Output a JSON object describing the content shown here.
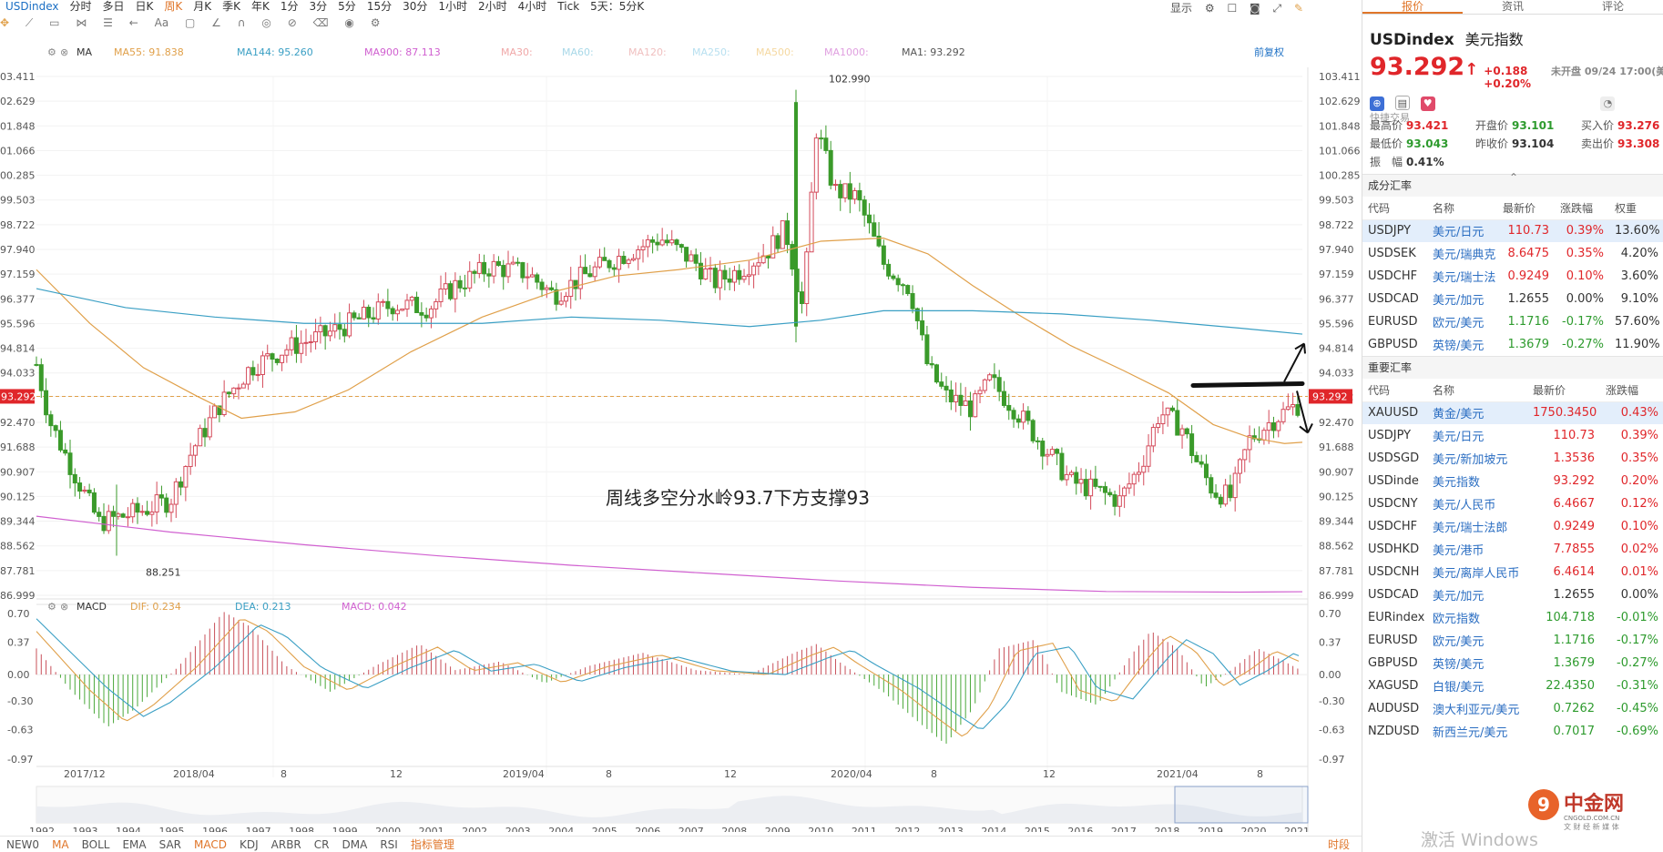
{
  "topbar": {
    "symbol": "USDindex",
    "periods": [
      "分时",
      "多日",
      "日K",
      "周K",
      "月K",
      "季K",
      "年K",
      "1分",
      "3分",
      "5分",
      "15分",
      "30分",
      "1小时",
      "2小时",
      "4小时",
      "Tick",
      "5天：5分K"
    ],
    "active_period": "周K",
    "display_label": "显示"
  },
  "ma_legend": {
    "name": "MA",
    "items": [
      {
        "label": "MA55: 91.838",
        "color": "#e0a04a"
      },
      {
        "label": "MA144: 95.260",
        "color": "#3a9fc4"
      },
      {
        "label": "MA900: 87.113",
        "color": "#d060d0"
      },
      {
        "label": "MA30:",
        "color": "#f0a8a8"
      },
      {
        "label": "MA60:",
        "color": "#a8d8e8"
      },
      {
        "label": "MA120:",
        "color": "#f0c0c0"
      },
      {
        "label": "MA250:",
        "color": "#b8e0f0"
      },
      {
        "label": "MA500:",
        "color": "#f5d8a0"
      },
      {
        "label": "MA1000:",
        "color": "#e0a0e0"
      },
      {
        "label": "MA1: 93.292",
        "color": "#555555"
      }
    ],
    "adjust_label": "前复权"
  },
  "price_axis": {
    "ticks": [
      "103.411",
      "102.629",
      "101.848",
      "101.066",
      "100.285",
      "99.503",
      "98.722",
      "97.940",
      "97.159",
      "96.377",
      "95.596",
      "94.814",
      "94.033",
      "93.292",
      "92.470",
      "91.688",
      "90.907",
      "90.125",
      "89.344",
      "88.562",
      "87.781",
      "86.999"
    ],
    "left_ticks": [
      "03.411",
      "02.629",
      "01.848",
      "01.066",
      "00.285",
      "99.503",
      "98.722",
      "97.940",
      "97.159",
      "96.377",
      "95.596",
      "94.814",
      "94.033",
      "93.292",
      "92.470",
      "91.688",
      "90.907",
      "90.125",
      "89.344",
      "88.562",
      "87.781",
      "86.999"
    ],
    "current": "93.292"
  },
  "annotations": {
    "high": "102.990",
    "low": "88.251",
    "note": "周线多空分水岭93.7下方支撑93"
  },
  "time_axis": [
    "2017/12",
    "2018/04",
    "8",
    "12",
    "2019/04",
    "8",
    "12",
    "2020/04",
    "8",
    "12",
    "2021/04",
    "8"
  ],
  "macd_legend": {
    "name": "MACD",
    "dif": "DIF: 0.234",
    "dea": "DEA: 0.213",
    "macd": "MACD: 0.042",
    "ticks": [
      "0.70",
      "0.37",
      "0.00",
      "-0.30",
      "-0.63",
      "-0.97"
    ]
  },
  "overview_years": [
    "1992",
    "1993",
    "1994",
    "1995",
    "1996",
    "1997",
    "1998",
    "1999",
    "2000",
    "2001",
    "2002",
    "2003",
    "2004",
    "2005",
    "2006",
    "2007",
    "2008",
    "2009",
    "2010",
    "2011",
    "2012",
    "2013",
    "2014",
    "2015",
    "2016",
    "2017",
    "2018",
    "2019",
    "2020",
    "2021"
  ],
  "bottom_indicators": [
    "NEW0",
    "MA",
    "BOLL",
    "EMA",
    "SAR",
    "MACD",
    "KDJ",
    "ARBR",
    "CR",
    "DMA",
    "RSI",
    "指标管理"
  ],
  "bottom_active": [
    "MA",
    "MACD"
  ],
  "bottom_right": "时段",
  "side": {
    "tabs": [
      "报价",
      "资讯",
      "评论"
    ],
    "active_tab": "报价",
    "symbol": "USDindex",
    "name_cn": "美元指数",
    "price": "93.292",
    "change": "+0.188",
    "change_pct": "+0.20%",
    "status": "未开盘 09/24 17:00(美",
    "quick_trade": "快捷交易",
    "stats": [
      {
        "label": "最高价",
        "value": "93.421",
        "tone": "up"
      },
      {
        "label": "开盘价",
        "value": "93.101",
        "tone": "dn"
      },
      {
        "label": "买入价",
        "value": "93.276",
        "tone": "up"
      },
      {
        "label": "最低价",
        "value": "93.043",
        "tone": "dn"
      },
      {
        "label": "昨收价",
        "value": "93.104",
        "tone": "neutral"
      },
      {
        "label": "卖出价",
        "value": "93.308",
        "tone": "up"
      },
      {
        "label": "振　幅",
        "value": "0.41%",
        "tone": "neutral"
      }
    ],
    "component_title": "成分汇率",
    "component_headers": [
      "代码",
      "名称",
      "最新价",
      "涨跌幅",
      "权重"
    ],
    "components": [
      {
        "code": "USDJPY",
        "name": "美元/日元",
        "price": "110.73",
        "pct": "0.39%",
        "weight": "13.60%",
        "tone": "up",
        "selected": true
      },
      {
        "code": "USDSEK",
        "name": "美元/瑞典克",
        "price": "8.6475",
        "pct": "0.35%",
        "weight": "4.20%",
        "tone": "up"
      },
      {
        "code": "USDCHF",
        "name": "美元/瑞士法",
        "price": "0.9249",
        "pct": "0.10%",
        "weight": "3.60%",
        "tone": "up"
      },
      {
        "code": "USDCAD",
        "name": "美元/加元",
        "price": "1.2655",
        "pct": "0.00%",
        "weight": "9.10%",
        "tone": "flat"
      },
      {
        "code": "EURUSD",
        "name": "欧元/美元",
        "price": "1.1716",
        "pct": "-0.17%",
        "weight": "57.60%",
        "tone": "dn"
      },
      {
        "code": "GBPUSD",
        "name": "英镑/美元",
        "price": "1.3679",
        "pct": "-0.27%",
        "weight": "11.90%",
        "tone": "dn"
      }
    ],
    "major_title": "重要汇率",
    "major_headers": [
      "代码",
      "名称",
      "最新价",
      "涨跌幅"
    ],
    "majors": [
      {
        "code": "XAUUSD",
        "name": "黄金/美元",
        "price": "1750.3450",
        "pct": "0.43%",
        "tone": "up",
        "selected": true
      },
      {
        "code": "USDJPY",
        "name": "美元/日元",
        "price": "110.73",
        "pct": "0.39%",
        "tone": "up"
      },
      {
        "code": "USDSGD",
        "name": "美元/新加坡元",
        "price": "1.3536",
        "pct": "0.35%",
        "tone": "up"
      },
      {
        "code": "USDinde",
        "name": "美元指数",
        "price": "93.292",
        "pct": "0.20%",
        "tone": "up"
      },
      {
        "code": "USDCNY",
        "name": "美元/人民币",
        "price": "6.4667",
        "pct": "0.12%",
        "tone": "up"
      },
      {
        "code": "USDCHF",
        "name": "美元/瑞士法郎",
        "price": "0.9249",
        "pct": "0.10%",
        "tone": "up"
      },
      {
        "code": "USDHKD",
        "name": "美元/港币",
        "price": "7.7855",
        "pct": "0.02%",
        "tone": "up"
      },
      {
        "code": "USDCNH",
        "name": "美元/离岸人民币",
        "price": "6.4614",
        "pct": "0.01%",
        "tone": "up"
      },
      {
        "code": "USDCAD",
        "name": "美元/加元",
        "price": "1.2655",
        "pct": "0.00%",
        "tone": "flat"
      },
      {
        "code": "EURindex",
        "name": "欧元指数",
        "price": "104.718",
        "pct": "-0.01%",
        "tone": "dn"
      },
      {
        "code": "EURUSD",
        "name": "欧元/美元",
        "price": "1.1716",
        "pct": "-0.17%",
        "tone": "dn"
      },
      {
        "code": "GBPUSD",
        "name": "英镑/美元",
        "price": "1.3679",
        "pct": "-0.27%",
        "tone": "dn"
      },
      {
        "code": "XAGUSD",
        "name": "白银/美元",
        "price": "22.4350",
        "pct": "-0.31%",
        "tone": "dn"
      },
      {
        "code": "AUDUSD",
        "name": "澳大利亚元/美元",
        "price": "0.7262",
        "pct": "-0.45%",
        "tone": "dn"
      },
      {
        "code": "NZDUSD",
        "name": "新西兰元/美元",
        "price": "0.7017",
        "pct": "-0.69%",
        "tone": "dn"
      }
    ],
    "logo_cn": "中金网",
    "logo_url": "CNGOLD.COM.CN",
    "logo_slogan": "文 财 经 新 媒 体",
    "activate": "激活 Windows"
  }
}
